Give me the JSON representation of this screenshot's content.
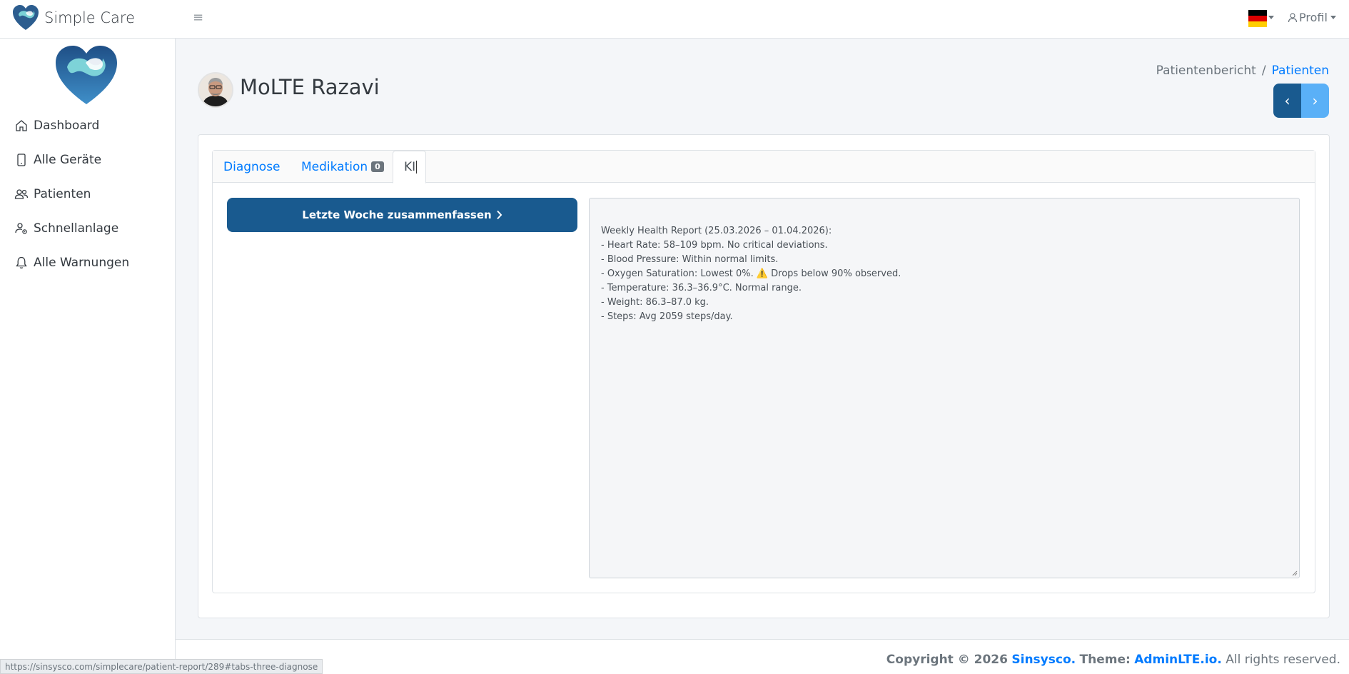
{
  "brand": {
    "name": "Simple Care"
  },
  "header": {
    "menu_icon": "hamburger-icon",
    "language_flag": "germany-flag",
    "profile_label": "Profil",
    "colors": {
      "flag_black": "#000000",
      "flag_red": "#dd0000",
      "flag_gold": "#ffce00"
    }
  },
  "sidebar": {
    "items": [
      {
        "label": "Dashboard",
        "icon": "house-icon"
      },
      {
        "label": "Alle Geräte",
        "icon": "phone-icon"
      },
      {
        "label": "Patienten",
        "icon": "people-icon"
      },
      {
        "label": "Schnellanlage",
        "icon": "person-gear-icon"
      },
      {
        "label": "Alle Warnungen",
        "icon": "bell-icon"
      }
    ]
  },
  "page": {
    "title": "MoLTE Razavi",
    "breadcrumb": {
      "current": "Patientenbericht",
      "separator": "/",
      "link": "Patienten"
    },
    "pager": {
      "prev": "‹",
      "next": "›"
    }
  },
  "tabs": [
    {
      "label": "Diagnose"
    },
    {
      "label": "Medikation",
      "badge": "0"
    },
    {
      "label": "KI",
      "active": true
    }
  ],
  "ki": {
    "button_label": "Letzte Woche zusammenfassen",
    "report_lines": [
      "Weekly Health Report (25.03.2026 – 01.04.2026):",
      "- Heart Rate: 58–109 bpm. No critical deviations.",
      "- Blood Pressure: Within normal limits.",
      "- Oxygen Saturation: Lowest 0%. ⚠️ Drops below 90% observed.",
      "- Temperature: 36.3–36.9°C. Normal range.",
      "- Weight: 86.3–87.0 kg.",
      "- Steps: Avg 2059 steps/day."
    ]
  },
  "footer": {
    "prefix": "Copyright © 2026",
    "company": "Sinsysco.",
    "theme_label": "Theme:",
    "theme": "AdminLTE.io.",
    "suffix": "All rights reserved."
  },
  "status_url": "https://sinsysco.com/simplecare/patient-report/289#tabs-three-diagnose",
  "colors": {
    "primary": "#195a8f",
    "link": "#007bff",
    "next_button": "#5ab0f7"
  }
}
